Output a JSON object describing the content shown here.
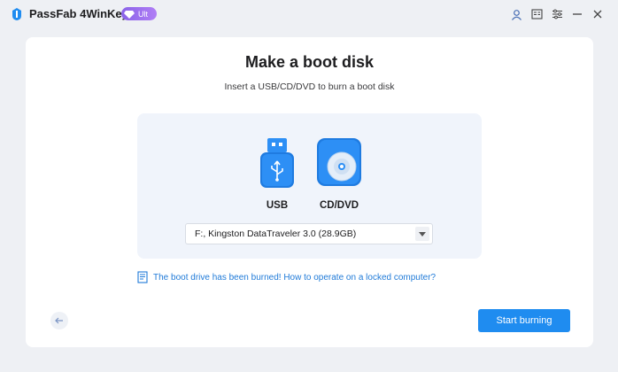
{
  "app": {
    "title": "PassFab 4WinKey",
    "badge": "Ult",
    "brand_color": "#1f8cf0"
  },
  "window_controls": [
    "user-icon",
    "feedback-icon",
    "settings-icon",
    "minimize-icon",
    "close-icon"
  ],
  "main": {
    "heading": "Make a boot disk",
    "subheading": "Insert a USB/CD/DVD to burn a boot disk",
    "options": [
      {
        "label": "USB",
        "icon": "usb-icon"
      },
      {
        "label": "CD/DVD",
        "icon": "cd-dvd-icon"
      }
    ],
    "drive_select": {
      "value": "F:, Kingston DataTraveler 3.0 (28.9GB)"
    },
    "help_link": "The boot drive has been burned! How to operate on a locked computer?",
    "start_button": "Start burning"
  }
}
